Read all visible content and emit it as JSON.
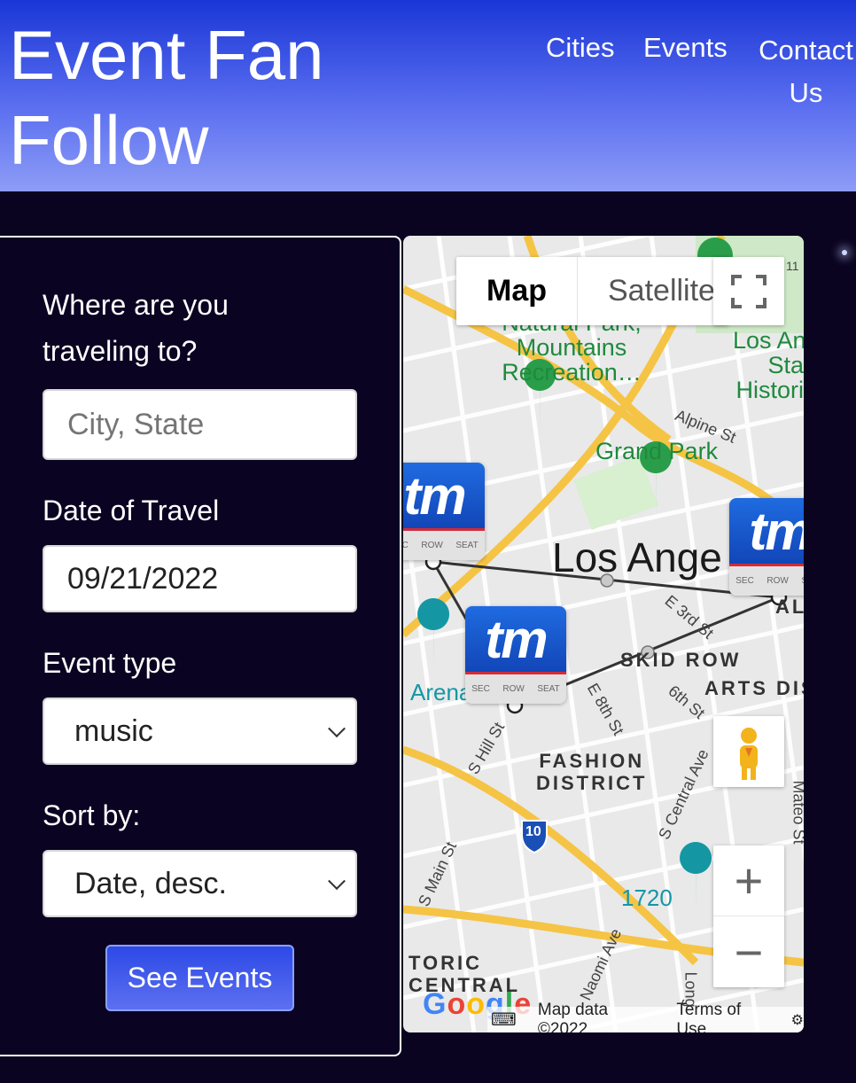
{
  "header": {
    "brand": "Event Fan Follow",
    "nav": [
      "Cities",
      "Events",
      "Contact Us"
    ]
  },
  "form": {
    "destination_label": "Where are you traveling to?",
    "destination_placeholder": "City, State",
    "date_label": "Date of Travel",
    "date_value": "09/21/2022",
    "event_type_label": "Event type",
    "event_type_value": "music",
    "sort_label": "Sort by:",
    "sort_value": "Date, desc.",
    "submit_label": "See Events"
  },
  "map": {
    "type_options": [
      "Map",
      "Satellite"
    ],
    "selected_type": "Map",
    "labels": {
      "park": "Natural Park, Mountains Recreation…",
      "park_line1": "Natural Park,",
      "park_line2": "Mountains",
      "park_line3": "Recreation…",
      "grand_park": "Grand Park",
      "alpine": "Alpine St",
      "city": "Los Ange",
      "historic_1": "Los An",
      "historic_2": "Sta",
      "historic_3": "Histori",
      "third": "E 3rd St",
      "skid_row": "SKID ROW",
      "arts": "ARTS DIS",
      "sixth": "6th St",
      "eighth": "E 8th St",
      "hill": "S Hill St",
      "fashion1": "FASHION",
      "fashion2": "DISTRICT",
      "central_ave": "S Central Ave",
      "mateo": "Mateo St",
      "main": "S Main St",
      "arena": "Arena",
      "i10": "10",
      "i11": "11",
      "venue_1720": "1720",
      "naomi": "Naomi Ave",
      "long": "Long",
      "toric": "TORIC",
      "central": "CENTRAL",
      "alis": "ALIS"
    },
    "marker_text": "tm",
    "marker_sub": [
      "SEC",
      "ROW",
      "SEAT"
    ],
    "google": "Google",
    "attribution_data": "Map data ©2022",
    "terms": "Terms of Use"
  }
}
